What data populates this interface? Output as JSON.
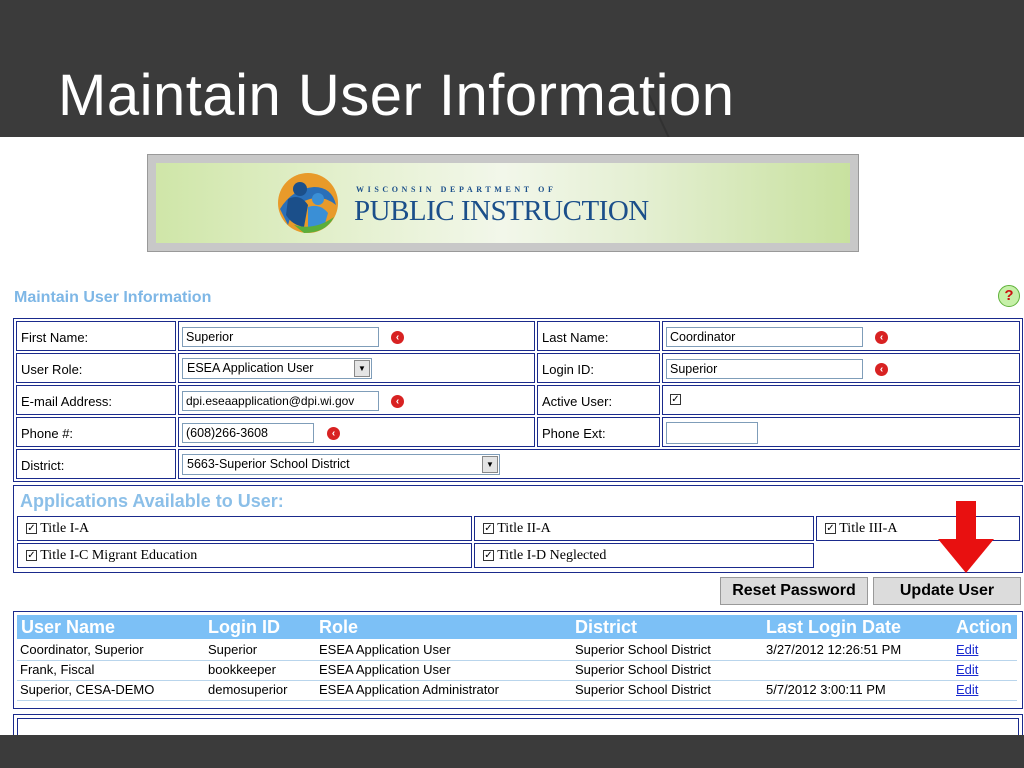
{
  "slide": {
    "title": "Maintain User Information"
  },
  "banner": {
    "small": "WISCONSIN DEPARTMENT OF",
    "big": "PUBLIC INSTRUCTION"
  },
  "section_title": "Maintain User Information",
  "help": "?",
  "form": {
    "first_name_label": "First Name:",
    "first_name_value": "Superior",
    "last_name_label": "Last Name:",
    "last_name_value": "Coordinator",
    "user_role_label": "User Role:",
    "user_role_value": "ESEA Application User",
    "login_id_label": "Login ID:",
    "login_id_value": "Superior",
    "email_label": "E-mail Address:",
    "email_value": "dpi.eseaapplication@dpi.wi.gov",
    "active_user_label": "Active User:",
    "active_user_checked": "☑",
    "phone_label": "Phone #:",
    "phone_value": "(608)266-3608",
    "phone_ext_label": "Phone Ext:",
    "phone_ext_value": "",
    "district_label": "District:",
    "district_value": "5663-Superior School District"
  },
  "applications": {
    "title": "Applications Available to User:",
    "items": [
      {
        "label": "Title I-A"
      },
      {
        "label": "Title II-A"
      },
      {
        "label": "Title III-A"
      },
      {
        "label": "Title I-C Migrant Education"
      },
      {
        "label": "Title I-D Neglected"
      }
    ]
  },
  "buttons": {
    "reset": "Reset Password",
    "update": "Update User"
  },
  "grid": {
    "headers": [
      "User Name",
      "Login ID",
      "Role",
      "District",
      "Last Login Date",
      "Action"
    ],
    "rows": [
      [
        "Coordinator, Superior",
        "Superior",
        "ESEA Application User",
        "Superior School District",
        "3/27/2012 12:26:51 PM",
        "Edit"
      ],
      [
        "Frank, Fiscal",
        "bookkeeper",
        "ESEA Application User",
        "Superior School District",
        "",
        "Edit"
      ],
      [
        "Superior, CESA-DEMO",
        "demosuperior",
        "ESEA Application Administrator",
        "Superior School District",
        "5/7/2012 3:00:11 PM",
        "Edit"
      ]
    ]
  },
  "colors": {
    "header_blue": "#7cc0f6",
    "border_navy": "#1a2a8c",
    "required_red": "#d82222",
    "arrow_red": "#e81010"
  }
}
